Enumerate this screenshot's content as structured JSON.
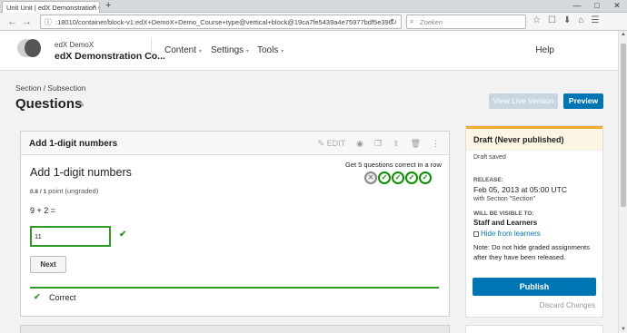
{
  "browser": {
    "tab_title": "Unit Unit | edX Demonstration C...",
    "tab_close": "×",
    "new_tab": "+",
    "window_controls": [
      "—",
      "□",
      "✕"
    ],
    "back": "←",
    "forward": "→",
    "url": ":18010/container/block-v1:edX+DemoX+Demo_Course+type@vertical+block@19ca7fe5439a4e75977bdf5e396",
    "search_placeholder": "Zoeken",
    "toolbar_icons": [
      "☆",
      "☐",
      "⬇",
      "⌂",
      "☰"
    ]
  },
  "header": {
    "org": "edX DemoX",
    "course": "edX Demonstration Co...",
    "menus": [
      {
        "label": "Content",
        "caret": "▾"
      },
      {
        "label": "Settings",
        "caret": "▾"
      },
      {
        "label": "Tools",
        "caret": "▾"
      }
    ],
    "help": "Help"
  },
  "page": {
    "breadcrumb": "Section  /  Subsection",
    "title": "Questions",
    "view_live": "View Live Version",
    "preview": "Preview"
  },
  "component": {
    "header_title": "Add 1-digit numbers",
    "edit_label": "✎ EDIT",
    "problem_title": "Add 1-digit numbers",
    "points_score": "0.8 / 1",
    "points_text": " point (ungraded)",
    "progress_label": "Get 5 questions correct in a row",
    "progress_marks": [
      "✕",
      "✓",
      "✓",
      "✓",
      "✓"
    ],
    "question": "9 + 2 =",
    "answer_value": "11",
    "answer_check": "✔",
    "next_label": "Next",
    "correct_icon": "✔",
    "correct_text": "Correct"
  },
  "sidebar": {
    "status": "Draft (Never published)",
    "draft_saved": "Draft saved",
    "release_label": "RELEASE:",
    "release_date": "Feb 05, 2013 at 05:00 UTC",
    "release_with": "with Section \"Section\"",
    "visible_label": "WILL BE VISIBLE TO:",
    "visible_to": "Staff and Learners",
    "hide_label": "Hide from learners",
    "note_line1": "Note: Do not hide graded assignments",
    "note_line2": "after they have been released.",
    "publish": "Publish",
    "discard": "Discard Changes"
  },
  "colors": {
    "primary": "#0075b4",
    "success": "#2e9c24",
    "draft_accent": "#f0ab2a"
  }
}
